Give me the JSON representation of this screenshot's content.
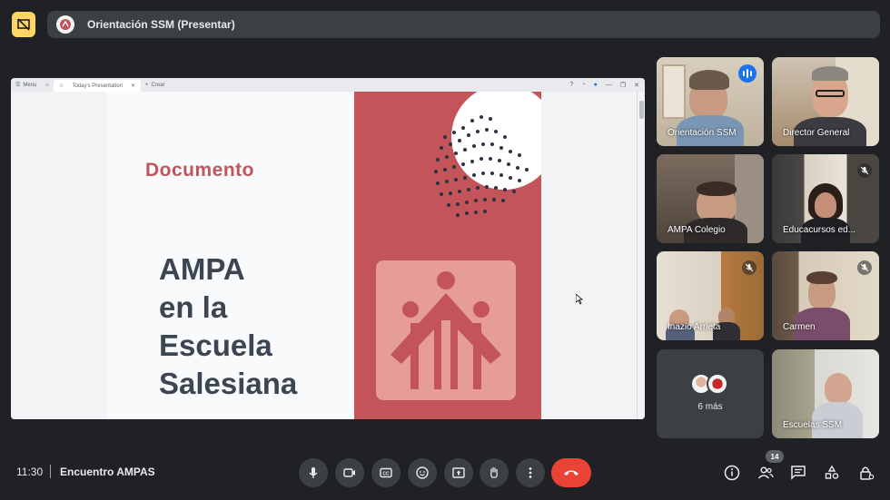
{
  "topbar": {
    "presenter_title": "Orientación SSM (Presentar)"
  },
  "shared_screen": {
    "browser": {
      "menu_label": "Menu",
      "tab_title": "Today's Presentation",
      "new_tab_label": "Crear"
    },
    "slide": {
      "doc_label": "Documento",
      "title_lines": [
        "AMPA",
        "en la",
        "Escuela",
        "Salesiana"
      ]
    }
  },
  "participants": [
    {
      "name": "Orientación SSM",
      "speaking": true,
      "muted": false
    },
    {
      "name": "Director General",
      "speaking": false,
      "muted": false
    },
    {
      "name": "AMPA Colegio",
      "speaking": false,
      "muted": false
    },
    {
      "name": "Educacursos ed...",
      "speaking": false,
      "muted": true
    },
    {
      "name": "Inazio Arrieta",
      "speaking": false,
      "muted": true
    },
    {
      "name": "Carmen",
      "speaking": false,
      "muted": true
    },
    {
      "name": "Escuelas SSM",
      "speaking": false,
      "muted": false
    }
  ],
  "more_tile": {
    "label": "6 más"
  },
  "bottombar": {
    "time": "11:30",
    "meeting_name": "Encuentro AMPAS",
    "people_count": "14"
  },
  "colors": {
    "background": "#202124",
    "slide_red": "#c2545a",
    "slide_text": "#3c4653",
    "end_call": "#ea4335",
    "present_badge": "#fdd663",
    "active_outline": "#8ab4f8"
  },
  "icons": [
    "stop-presenting-icon",
    "mic-icon",
    "camera-icon",
    "captions-icon",
    "emoji-icon",
    "present-screen-icon",
    "raise-hand-icon",
    "more-options-icon",
    "end-call-icon",
    "info-icon",
    "people-icon",
    "chat-icon",
    "activities-icon",
    "host-controls-icon",
    "mic-off-icon"
  ]
}
